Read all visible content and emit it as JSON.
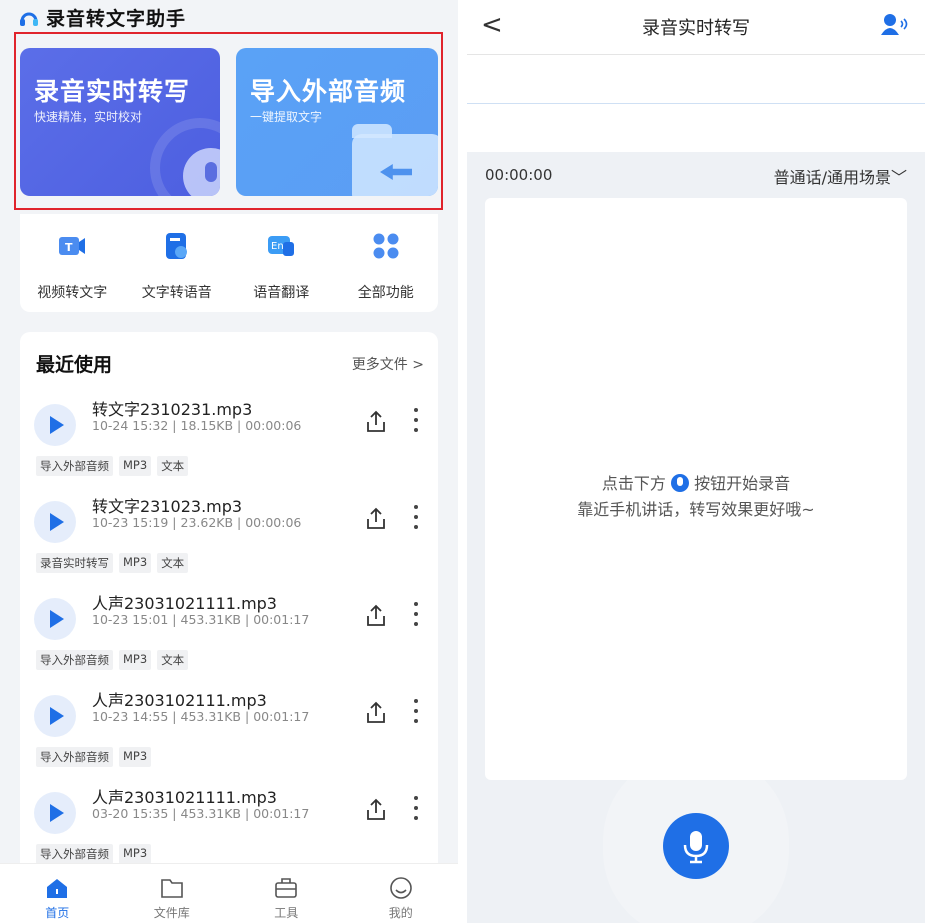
{
  "left": {
    "app_title": "录音转文字助手",
    "cards": [
      {
        "title": "录音实时转写",
        "subtitle": "快速精准，实时校对"
      },
      {
        "title": "导入外部音频",
        "subtitle": "一键提取文字"
      }
    ],
    "tools": [
      {
        "label": "视频转文字",
        "icon": "video-to-text-icon"
      },
      {
        "label": "文字转语音",
        "icon": "text-to-speech-icon"
      },
      {
        "label": "语音翻译",
        "icon": "voice-translate-icon"
      },
      {
        "label": "全部功能",
        "icon": "all-features-icon"
      }
    ],
    "recent": {
      "title": "最近使用",
      "more": "更多文件 >",
      "items": [
        {
          "name": "转文字2310231.mp3",
          "date": "10-24 15:32",
          "size": "18.15KB",
          "duration": "00:00:06",
          "tags": [
            "导入外部音频",
            "MP3",
            "文本"
          ]
        },
        {
          "name": "转文字231023.mp3",
          "date": "10-23 15:19",
          "size": "23.62KB",
          "duration": "00:00:06",
          "tags": [
            "录音实时转写",
            "MP3",
            "文本"
          ]
        },
        {
          "name": "人声23031021111.mp3",
          "date": "10-23 15:01",
          "size": "453.31KB",
          "duration": "00:01:17",
          "tags": [
            "导入外部音频",
            "MP3",
            "文本"
          ]
        },
        {
          "name": "人声2303102111.mp3",
          "date": "10-23 14:55",
          "size": "453.31KB",
          "duration": "00:01:17",
          "tags": [
            "导入外部音频",
            "MP3"
          ]
        },
        {
          "name": "人声23031021111.mp3",
          "date": "03-20 15:35",
          "size": "453.31KB",
          "duration": "00:01:17",
          "tags": [
            "导入外部音频",
            "MP3"
          ]
        }
      ]
    },
    "tabs": [
      {
        "label": "首页",
        "active": true
      },
      {
        "label": "文件库",
        "active": false
      },
      {
        "label": "工具",
        "active": false
      },
      {
        "label": "我的",
        "active": false
      }
    ]
  },
  "right": {
    "back": "<",
    "title": "录音实时转写",
    "time": "00:00:00",
    "mode": "普通话/通用场景﹀",
    "hint_prefix": "点击下方",
    "hint_suffix": "按钮开始录音",
    "hint_line2": "靠近手机讲话，转写效果更好哦~"
  },
  "colors": {
    "accent": "#1f6fe6",
    "highlight_box": "#e0232c",
    "card1": "#5064e3",
    "card2": "#5aa2f6"
  }
}
